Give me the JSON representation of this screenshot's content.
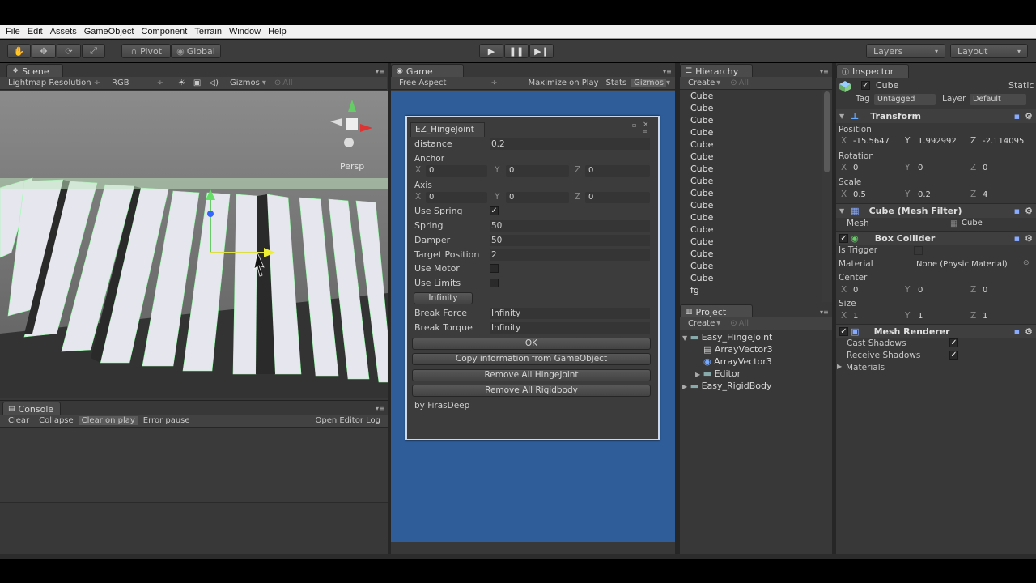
{
  "menu": [
    "File",
    "Edit",
    "Assets",
    "GameObject",
    "Component",
    "Terrain",
    "Window",
    "Help"
  ],
  "toolbar": {
    "pivot": "Pivot",
    "global": "Global",
    "layers": "Layers",
    "layout": "Layout"
  },
  "scene": {
    "tab": "Scene",
    "bar": {
      "lightmap": "Lightmap Resolution",
      "rgb": "RGB",
      "gizmos": "Gizmos",
      "search": "All"
    },
    "persp": "Persp"
  },
  "console": {
    "tab": "Console",
    "buttons": [
      "Clear",
      "Collapse",
      "Clear on play",
      "Error pause"
    ],
    "open_log": "Open Editor Log"
  },
  "game": {
    "tab": "Game",
    "aspect": "Free Aspect",
    "maximize": "Maximize on Play",
    "stats": "Stats",
    "gizmos": "Gizmos"
  },
  "ez": {
    "title": "EZ_HingeJoint",
    "distance_label": "distance",
    "distance": "0.2",
    "anchor_label": "Anchor",
    "anchor": {
      "x": "0",
      "y": "0",
      "z": "0"
    },
    "axis_label": "Axis",
    "axis": {
      "x": "0",
      "y": "0",
      "z": "0"
    },
    "use_spring": "Use Spring",
    "spring_label": "Spring",
    "spring": "50",
    "damper_label": "Damper",
    "damper": "50",
    "target_label": "Target Position",
    "target": "2",
    "use_motor": "Use Motor",
    "use_limits": "Use Limits",
    "infinity_btn": "Infinity",
    "break_force_label": "Break Force",
    "break_force": "Infinity",
    "break_torque_label": "Break Torque",
    "break_torque": "Infinity",
    "ok": "OK",
    "copy": "Copy information from GameObject",
    "remove_hinge": "Remove All HingeJoint",
    "remove_rb": "Remove All Rigidbody",
    "credit": "by FirasDeep",
    "x": "X",
    "y": "Y",
    "z": "Z"
  },
  "hierarchy": {
    "tab": "Hierarchy",
    "create": "Create",
    "search": "All",
    "items": [
      "Cube",
      "Cube",
      "Cube",
      "Cube",
      "Cube",
      "Cube",
      "Cube",
      "Cube",
      "Cube",
      "Cube",
      "Cube",
      "Cube",
      "Cube",
      "Cube",
      "Cube",
      "Cube",
      "fg"
    ]
  },
  "project": {
    "tab": "Project",
    "create": "Create",
    "search": "All",
    "tree": {
      "root1": "Easy_HingeJoint",
      "child1": "ArrayVector3",
      "child2": "ArrayVector3",
      "child3": "Editor",
      "root2": "Easy_RigidBody"
    }
  },
  "inspector": {
    "tab": "Inspector",
    "object_name": "Cube",
    "static": "Static",
    "tag_label": "Tag",
    "tag": "Untagged",
    "layer_label": "Layer",
    "layer": "Default",
    "transform": {
      "title": "Transform",
      "position_label": "Position",
      "position": {
        "x": "-15.5647",
        "y": "1.992992",
        "z": "-2.114095"
      },
      "rotation_label": "Rotation",
      "rotation": {
        "x": "0",
        "y": "0",
        "z": "0"
      },
      "scale_label": "Scale",
      "scale": {
        "x": "0.5",
        "y": "0.2",
        "z": "4"
      }
    },
    "mesh_filter": {
      "title": "Cube (Mesh Filter)",
      "mesh_label": "Mesh",
      "mesh": "Cube"
    },
    "box_collider": {
      "title": "Box Collider",
      "is_trigger": "Is Trigger",
      "material_label": "Material",
      "material": "None (Physic Material)",
      "center_label": "Center",
      "center": {
        "x": "0",
        "y": "0",
        "z": "0"
      },
      "size_label": "Size",
      "size": {
        "x": "1",
        "y": "1",
        "z": "1"
      }
    },
    "mesh_renderer": {
      "title": "Mesh Renderer",
      "cast_shadows": "Cast Shadows",
      "receive_shadows": "Receive Shadows",
      "materials": "Materials"
    },
    "x": "X",
    "y": "Y",
    "z": "Z"
  },
  "colors": {
    "game_bg": "#2f5d9a",
    "panel": "#383838",
    "menubar": "#f0f0f0"
  }
}
